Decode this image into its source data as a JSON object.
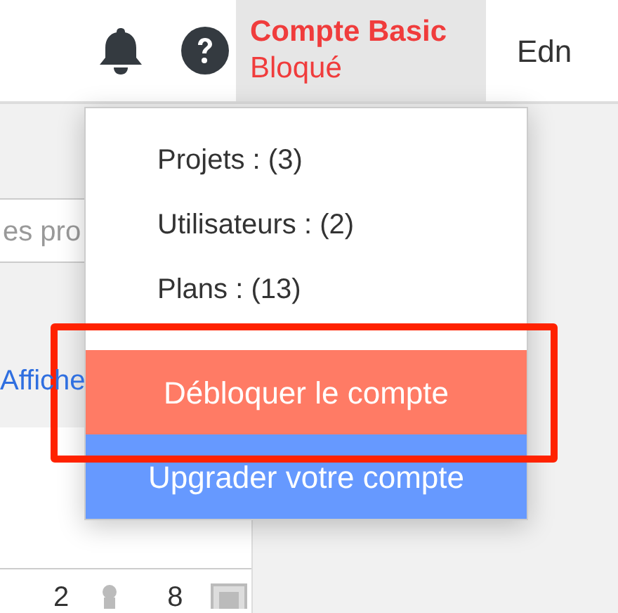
{
  "header": {
    "notifications": {
      "kind": "bell"
    },
    "help": {
      "kind": "help"
    },
    "account": {
      "plan": "Compte Basic",
      "status": "Bloqué",
      "blocked": true
    },
    "user_name": "Edn"
  },
  "left_panel": {
    "search": {
      "placeholder": "es pro"
    },
    "link": "Affiche",
    "stats": [
      {
        "value": "2",
        "kind": "person"
      },
      {
        "value": "8",
        "kind": "square"
      }
    ]
  },
  "account_menu": {
    "items": [
      {
        "label": "Projets : (3)"
      },
      {
        "label": "Utilisateurs : (2)"
      },
      {
        "label": "Plans : (13)"
      }
    ],
    "actions": [
      {
        "label": "Débloquer le compte",
        "kind": "danger",
        "highlighted": true
      },
      {
        "label": "Upgrader votre compte",
        "kind": "primary",
        "highlighted": false
      }
    ]
  }
}
